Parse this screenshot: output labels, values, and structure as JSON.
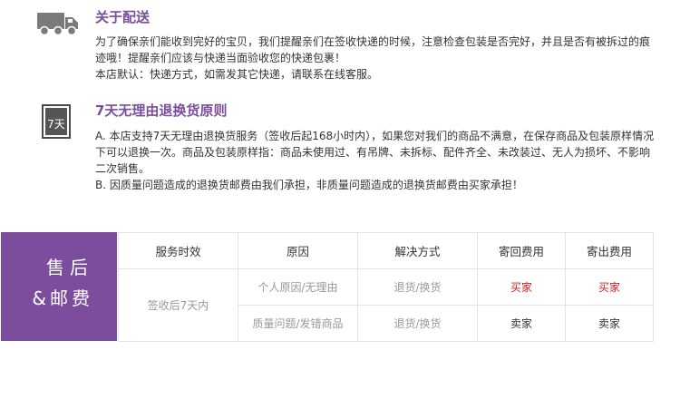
{
  "shipping": {
    "title": "关于配送",
    "icon": "truck-icon",
    "lines": [
      "为了确保亲们能收到完好的宝贝，我们提醒亲们在签收快递的时候，注意检查包装是否完好，并且是否有被拆过的痕迹哦！提醒亲们应该与快递当面验收您的快递包裹！",
      "本店默认：快递方式，如需发其它快递，请联系在线客服。"
    ]
  },
  "returns": {
    "title": "7天无理由退换货原则",
    "icon": "seven-day-icon",
    "icon_text": "7天",
    "lines": [
      "A. 本店支持7天无理由退换货服务（签收后起168小时内），如果您对我们的商品不满意，在保存商品及包装原样情况下可以退换一次。商品及包装原样指：商品未使用过、有吊牌、未拆标、配件齐全、未改装过、无人为损坏、不影响二次销售。",
      "B. 因质量问题造成的退换货邮费由我们承担，非质量问题造成的退换货邮费由买家承担！"
    ]
  },
  "aftersale": {
    "label_line1": "售后",
    "label_line2": "&邮费",
    "label_color": "#7b4d9c",
    "headers": [
      "服务时效",
      "原因",
      "解决方式",
      "寄回费用",
      "寄出费用"
    ],
    "service_period": "签收后7天内",
    "rows": [
      {
        "reason": "个人原因/无理由",
        "solution": "退货/换货",
        "return_fee": "买家",
        "send_fee": "买家"
      },
      {
        "reason": "质量问题/发错商品",
        "solution": "退货/换货",
        "return_fee": "卖家",
        "send_fee": "卖家"
      }
    ],
    "buyer_fee_color": "#cc2222"
  }
}
